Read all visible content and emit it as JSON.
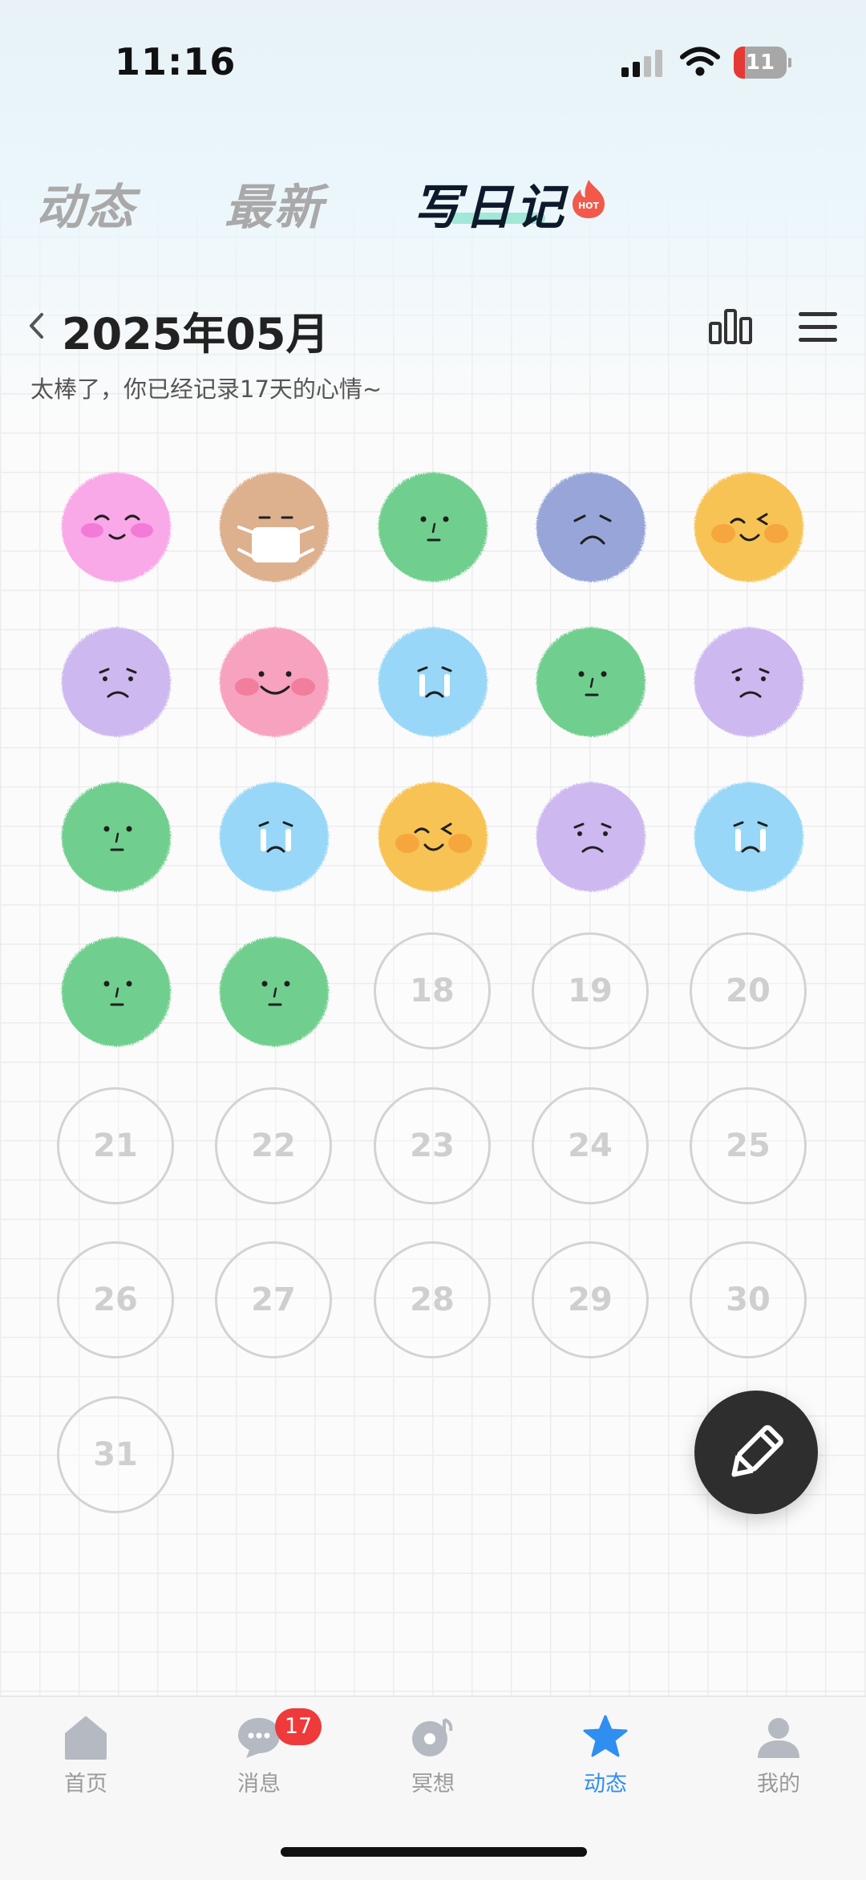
{
  "status_bar": {
    "time": "11:16",
    "battery": "11"
  },
  "top_tabs": [
    {
      "label": "动态"
    },
    {
      "label": "最新"
    },
    {
      "label": "写日记",
      "badge": "HOT"
    }
  ],
  "header": {
    "month": "2025年05月",
    "subtitle": "太棒了，你已经记录17天的心情~"
  },
  "calendar": {
    "recorded_days": [
      {
        "day": 1,
        "mood": "blush-happy",
        "color": "#f9a8e8"
      },
      {
        "day": 2,
        "mood": "masked",
        "color": "#ddb08e"
      },
      {
        "day": 3,
        "mood": "neutral",
        "color": "#6fcf8e"
      },
      {
        "day": 4,
        "mood": "sad",
        "color": "#97a5d8"
      },
      {
        "day": 5,
        "mood": "wink",
        "color": "#f8c354"
      },
      {
        "day": 6,
        "mood": "worried",
        "color": "#cdb8f0"
      },
      {
        "day": 7,
        "mood": "smile",
        "color": "#f7a2bf"
      },
      {
        "day": 8,
        "mood": "crying",
        "color": "#98d7f7"
      },
      {
        "day": 9,
        "mood": "neutral",
        "color": "#6fcf8e"
      },
      {
        "day": 10,
        "mood": "worried",
        "color": "#cdb8f0"
      },
      {
        "day": 11,
        "mood": "neutral",
        "color": "#6fcf8e"
      },
      {
        "day": 12,
        "mood": "crying",
        "color": "#98d7f7"
      },
      {
        "day": 13,
        "mood": "wink",
        "color": "#f8c354"
      },
      {
        "day": 14,
        "mood": "worried",
        "color": "#cdb8f0"
      },
      {
        "day": 15,
        "mood": "crying",
        "color": "#98d7f7"
      },
      {
        "day": 16,
        "mood": "neutral",
        "color": "#6fcf8e"
      },
      {
        "day": 17,
        "mood": "neutral",
        "color": "#6fcf8e"
      }
    ],
    "empty_days": [
      "18",
      "19",
      "20",
      "21",
      "22",
      "23",
      "24",
      "25",
      "26",
      "27",
      "28",
      "29",
      "30",
      "31"
    ]
  },
  "fab": {
    "icon": "pencil-icon"
  },
  "bottom_nav": {
    "items": [
      {
        "label": "首页",
        "icon": "home-icon"
      },
      {
        "label": "消息",
        "icon": "chat-icon",
        "badge": "17"
      },
      {
        "label": "冥想",
        "icon": "music-disc-icon"
      },
      {
        "label": "动态",
        "icon": "star-icon",
        "active": true
      },
      {
        "label": "我的",
        "icon": "profile-icon"
      }
    ]
  },
  "colors": {
    "accent": "#2f8ff0",
    "badge": "#ee3a3a",
    "fab": "#2e2e2e"
  }
}
